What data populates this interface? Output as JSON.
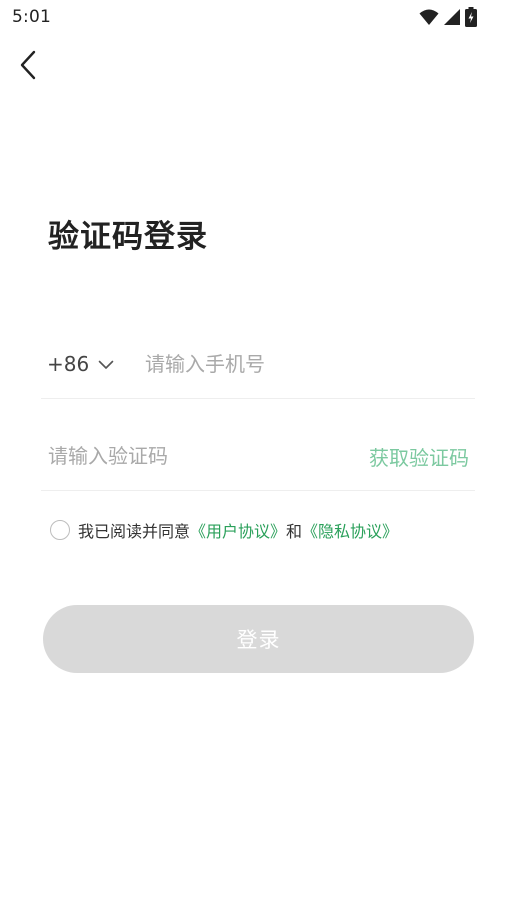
{
  "status_bar": {
    "time": "5:01",
    "icons": [
      "wifi-icon",
      "cellular-signal-icon",
      "battery-charging-icon"
    ]
  },
  "nav": {
    "back_icon": "chevron-left-icon"
  },
  "page": {
    "title": "验证码登录"
  },
  "phone": {
    "country_code": "+86",
    "dropdown_icon": "chevron-down-icon",
    "value": "",
    "placeholder": "请输入手机号"
  },
  "code": {
    "value": "",
    "placeholder": "请输入验证码",
    "get_code_label": "获取验证码"
  },
  "agreement": {
    "checked": false,
    "prefix": "我已阅读并同意",
    "user_agreement": "《用户协议》",
    "conjunction": "和",
    "privacy_policy": "《隐私协议》"
  },
  "login": {
    "label": "登录"
  },
  "colors": {
    "accent_link": "#2aa05a",
    "get_code_disabled": "#7cc9a0",
    "button_disabled_bg": "#d9d9d9",
    "placeholder": "#a9a9a9"
  }
}
